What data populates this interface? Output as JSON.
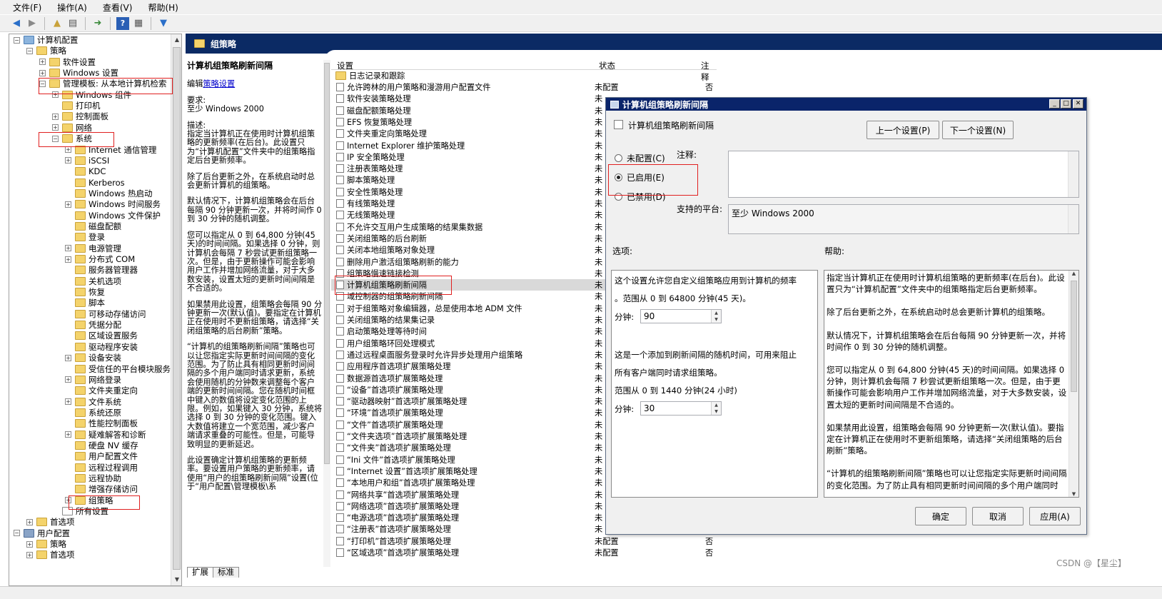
{
  "menu": [
    "文件(F)",
    "操作(A)",
    "查看(V)",
    "帮助(H)"
  ],
  "toolbar": {
    "icons": [
      "back-arrow",
      "forward-arrow",
      "up-folder",
      "show-hide-tree",
      "export-list",
      "help",
      "properties",
      "filter"
    ]
  },
  "tree": [
    {
      "label": "计算机配置",
      "icon": "computer",
      "level": 0,
      "exp": "−"
    },
    {
      "label": "策略",
      "level": 1,
      "exp": "−"
    },
    {
      "label": "软件设置",
      "level": 2,
      "exp": "+"
    },
    {
      "label": "Windows 设置",
      "level": 2,
      "exp": "+"
    },
    {
      "label": "管理模板: 从本地计算机检索",
      "level": 2,
      "exp": "−"
    },
    {
      "label": "Windows 组件",
      "level": 3,
      "exp": "+"
    },
    {
      "label": "打印机",
      "level": 3,
      "exp": ""
    },
    {
      "label": "控制面板",
      "level": 3,
      "exp": "+"
    },
    {
      "label": "网络",
      "level": 3,
      "exp": "+"
    },
    {
      "label": "系统",
      "level": 3,
      "exp": "−"
    },
    {
      "label": "Internet 通信管理",
      "level": 4,
      "exp": "+"
    },
    {
      "label": "iSCSI",
      "level": 4,
      "exp": "+"
    },
    {
      "label": "KDC",
      "level": 4,
      "exp": ""
    },
    {
      "label": "Kerberos",
      "level": 4,
      "exp": ""
    },
    {
      "label": "Windows 热启动",
      "level": 4,
      "exp": ""
    },
    {
      "label": "Windows 时间服务",
      "level": 4,
      "exp": "+"
    },
    {
      "label": "Windows 文件保护",
      "level": 4,
      "exp": ""
    },
    {
      "label": "磁盘配额",
      "level": 4,
      "exp": ""
    },
    {
      "label": "登录",
      "level": 4,
      "exp": ""
    },
    {
      "label": "电源管理",
      "level": 4,
      "exp": "+"
    },
    {
      "label": "分布式 COM",
      "level": 4,
      "exp": "+"
    },
    {
      "label": "服务器管理器",
      "level": 4,
      "exp": ""
    },
    {
      "label": "关机选项",
      "level": 4,
      "exp": ""
    },
    {
      "label": "恢复",
      "level": 4,
      "exp": ""
    },
    {
      "label": "脚本",
      "level": 4,
      "exp": ""
    },
    {
      "label": "可移动存储访问",
      "level": 4,
      "exp": ""
    },
    {
      "label": "凭据分配",
      "level": 4,
      "exp": ""
    },
    {
      "label": "区域设置服务",
      "level": 4,
      "exp": ""
    },
    {
      "label": "驱动程序安装",
      "level": 4,
      "exp": ""
    },
    {
      "label": "设备安装",
      "level": 4,
      "exp": "+"
    },
    {
      "label": "受信任的平台模块服务",
      "level": 4,
      "exp": ""
    },
    {
      "label": "网络登录",
      "level": 4,
      "exp": "+"
    },
    {
      "label": "文件夹重定向",
      "level": 4,
      "exp": ""
    },
    {
      "label": "文件系统",
      "level": 4,
      "exp": "+"
    },
    {
      "label": "系统还原",
      "level": 4,
      "exp": ""
    },
    {
      "label": "性能控制面板",
      "level": 4,
      "exp": ""
    },
    {
      "label": "疑难解答和诊断",
      "level": 4,
      "exp": "+"
    },
    {
      "label": "硬盘 NV 缓存",
      "level": 4,
      "exp": ""
    },
    {
      "label": "用户配置文件",
      "level": 4,
      "exp": ""
    },
    {
      "label": "远程过程调用",
      "level": 4,
      "exp": ""
    },
    {
      "label": "远程协助",
      "level": 4,
      "exp": ""
    },
    {
      "label": "增强存储访问",
      "level": 4,
      "exp": ""
    },
    {
      "label": "组策略",
      "level": 4,
      "exp": "+"
    },
    {
      "label": "所有设置",
      "level": 3,
      "exp": "",
      "icon": "doc"
    },
    {
      "label": "首选项",
      "level": 1,
      "exp": "+"
    },
    {
      "label": "用户配置",
      "icon": "user",
      "level": 0,
      "exp": "−"
    },
    {
      "label": "策略",
      "level": 1,
      "exp": "+"
    },
    {
      "label": "首选项",
      "level": 1,
      "exp": "+"
    }
  ],
  "band_title": "组策略",
  "description": {
    "title": "计算机组策略刷新间隔",
    "edit_prefix": "编辑",
    "edit_link": "策略设置",
    "requirements_label": "要求:",
    "requirements": "至少 Windows 2000",
    "description_label": "描述:",
    "paragraphs": [
      "指定当计算机正在使用时计算机组策略的更新频率(在后台)。此设置只为“计算机配置”文件夹中的组策略指定后台更新频率。",
      "除了后台更新之外，在系统启动时总会更新计算机的组策略。",
      "默认情况下，计算机组策略会在后台每隔 90 分钟更新一次，并将时间作 0 到 30 分钟的随机调整。",
      "您可以指定从 0 到 64,800 分钟(45 天)的时间间隔。如果选择 0 分钟，则计算机会每隔 7 秒尝试更新组策略一次。但是，由于更新操作可能会影响用户工作并增加网络流量，对于大多数安装，设置太短的更新时间间隔是不合适的。",
      "如果禁用此设置，组策略会每隔 90 分钟更新一次(默认值)。要指定在计算机正在使用时不更新组策略，请选择“关闭组策略的后台刷新”策略。",
      "“计算机的组策略刷新间隔”策略也可以让您指定实际更新时间间隔的变化范围。为了防止具有相同更新时间间隔的多个用户端同时请求更新，系统会使用随机的分钟数来调整每个客户端的更新时间间隔。您在随机时间框中键入的数值将设定变化范围的上限。例如，如果键入 30 分钟，系统将选择 0 到 30 分钟的变化范围。键入大数值将建立一个宽范围，减少客户端请求重叠的可能性。但是，可能导致明显的更新延迟。",
      "此设置确定计算机组策略的更新频率。要设置用户策略的更新频率，请使用“用户的组策略刷新间隔”设置(位于“用户配置\\管理模板\\系"
    ]
  },
  "list": {
    "headers": {
      "name": "设置",
      "state": "状态",
      "note": "注释"
    },
    "folder_row": "日志记录和跟踪",
    "rows": [
      {
        "name": "允许跨林的用户策略和漫游用户配置文件",
        "state": "未配置",
        "note": "否"
      },
      {
        "name": "软件安装策略处理",
        "state": "未",
        "note": ""
      },
      {
        "name": "磁盘配额策略处理",
        "state": "未",
        "note": ""
      },
      {
        "name": "EFS 恢复策略处理",
        "state": "未",
        "note": ""
      },
      {
        "name": "文件夹重定向策略处理",
        "state": "未",
        "note": ""
      },
      {
        "name": "Internet Explorer 维护策略处理",
        "state": "未",
        "note": ""
      },
      {
        "name": "IP 安全策略处理",
        "state": "未",
        "note": ""
      },
      {
        "name": "注册表策略处理",
        "state": "未",
        "note": ""
      },
      {
        "name": "脚本策略处理",
        "state": "未",
        "note": ""
      },
      {
        "name": "安全性策略处理",
        "state": "未",
        "note": ""
      },
      {
        "name": "有线策略处理",
        "state": "未",
        "note": ""
      },
      {
        "name": "无线策略处理",
        "state": "未",
        "note": ""
      },
      {
        "name": "不允许交互用户生成策略的结果集数据",
        "state": "未",
        "note": ""
      },
      {
        "name": "关闭组策略的后台刷新",
        "state": "未",
        "note": ""
      },
      {
        "name": "关闭本地组策略对象处理",
        "state": "未",
        "note": ""
      },
      {
        "name": "删除用户激活组策略刷新的能力",
        "state": "未",
        "note": ""
      },
      {
        "name": "组策略慢速链接检测",
        "state": "未",
        "note": ""
      },
      {
        "name": "计算机组策略刷新间隔",
        "state": "未",
        "note": "",
        "selected": true
      },
      {
        "name": "域控制器的组策略刷新间隔",
        "state": "未",
        "note": ""
      },
      {
        "name": "对于组策略对象编辑器，总是使用本地 ADM 文件",
        "state": "未",
        "note": ""
      },
      {
        "name": "关闭组策略的结果集记录",
        "state": "未",
        "note": ""
      },
      {
        "name": "启动策略处理等待时间",
        "state": "未",
        "note": ""
      },
      {
        "name": "用户组策略环回处理模式",
        "state": "未",
        "note": ""
      },
      {
        "name": "通过远程桌面服务登录时允许异步处理用户组策略",
        "state": "未",
        "note": ""
      },
      {
        "name": "应用程序首选项扩展策略处理",
        "state": "未",
        "note": ""
      },
      {
        "name": "数据源首选项扩展策略处理",
        "state": "未",
        "note": ""
      },
      {
        "name": "“设备”首选项扩展策略处理",
        "state": "未",
        "note": ""
      },
      {
        "name": "“驱动器映射”首选项扩展策略处理",
        "state": "未",
        "note": ""
      },
      {
        "name": "“环境”首选项扩展策略处理",
        "state": "未",
        "note": ""
      },
      {
        "name": "“文件”首选项扩展策略处理",
        "state": "未",
        "note": ""
      },
      {
        "name": "“文件夹选项”首选项扩展策略处理",
        "state": "未",
        "note": ""
      },
      {
        "name": "“文件夹”首选项扩展策略处理",
        "state": "未",
        "note": ""
      },
      {
        "name": "“Ini 文件”首选项扩展策略处理",
        "state": "未",
        "note": ""
      },
      {
        "name": "“Internet 设置”首选项扩展策略处理",
        "state": "未",
        "note": ""
      },
      {
        "name": "“本地用户和组”首选项扩展策略处理",
        "state": "未",
        "note": ""
      },
      {
        "name": "“网络共享”首选项扩展策略处理",
        "state": "未",
        "note": ""
      },
      {
        "name": "“网络选项”首选项扩展策略处理",
        "state": "未",
        "note": ""
      },
      {
        "name": "“电源选项”首选项扩展策略处理",
        "state": "未",
        "note": ""
      },
      {
        "name": "“注册表”首选项扩展策略处理",
        "state": "未",
        "note": ""
      },
      {
        "name": "“打印机”首选项扩展策略处理",
        "state": "未配置",
        "note": "否"
      },
      {
        "name": "“区域选项”首选项扩展策略处理",
        "state": "未配置",
        "note": "否"
      }
    ]
  },
  "dialog": {
    "title": "计算机组策略刷新间隔",
    "subtitle": "计算机组策略刷新间隔",
    "prev_button": "上一个设置(P)",
    "next_button": "下一个设置(N)",
    "radio_not_configured": "未配置(C)",
    "radio_enabled": "已启用(E)",
    "radio_disabled": "已禁用(D)",
    "comment_label": "注释:",
    "comment_value": "",
    "platform_label": "支持的平台:",
    "platform_value": "至少 Windows 2000",
    "options_label": "选项:",
    "help_label": "帮助:",
    "options": {
      "line1": "这个设置允许您自定义组策略应用到计算机的频率",
      "line2": "。范围从 0 到 64800 分钟(45 天)。",
      "minutes_label": "分钟:",
      "minutes_value": "90",
      "line3": "这是一个添加到刷新间隔的随机时间，可用来阻止",
      "line4": "所有客户端同时请求组策略。",
      "line5": "范围从 0 到 1440 分钟(24 小时)",
      "random_label": "分钟:",
      "random_value": "30"
    },
    "help_paragraphs": [
      "指定当计算机正在使用时计算机组策略的更新频率(在后台)。此设置只为“计算机配置”文件夹中的组策略指定后台更新频率。",
      "除了后台更新之外，在系统启动时总会更新计算机的组策略。",
      "默认情况下，计算机组策略会在后台每隔 90 分钟更新一次，并将时间作 0 到 30 分钟的随机调整。",
      "您可以指定从 0 到 64,800 分钟(45 天)的时间间隔。如果选择 0 分钟，则计算机会每隔 7 秒尝试更新组策略一次。但是，由于更新操作可能会影响用户工作并增加网络流量，对于大多数安装，设置太短的更新时间间隔是不合适的。",
      "如果禁用此设置，组策略会每隔 90 分钟更新一次(默认值)。要指定在计算机正在使用时不更新组策略，请选择“关闭组策略的后台刷新”策略。",
      "“计算机的组策略刷新间隔”策略也可以让您指定实际更新时间间隔的变化范围。为了防止具有相同更新时间间隔的多个用户端同时"
    ],
    "ok": "确定",
    "cancel": "取消",
    "apply": "应用(A)"
  },
  "tabs": [
    "扩展",
    "标准"
  ],
  "watermark": "CSDN @【星尘】"
}
